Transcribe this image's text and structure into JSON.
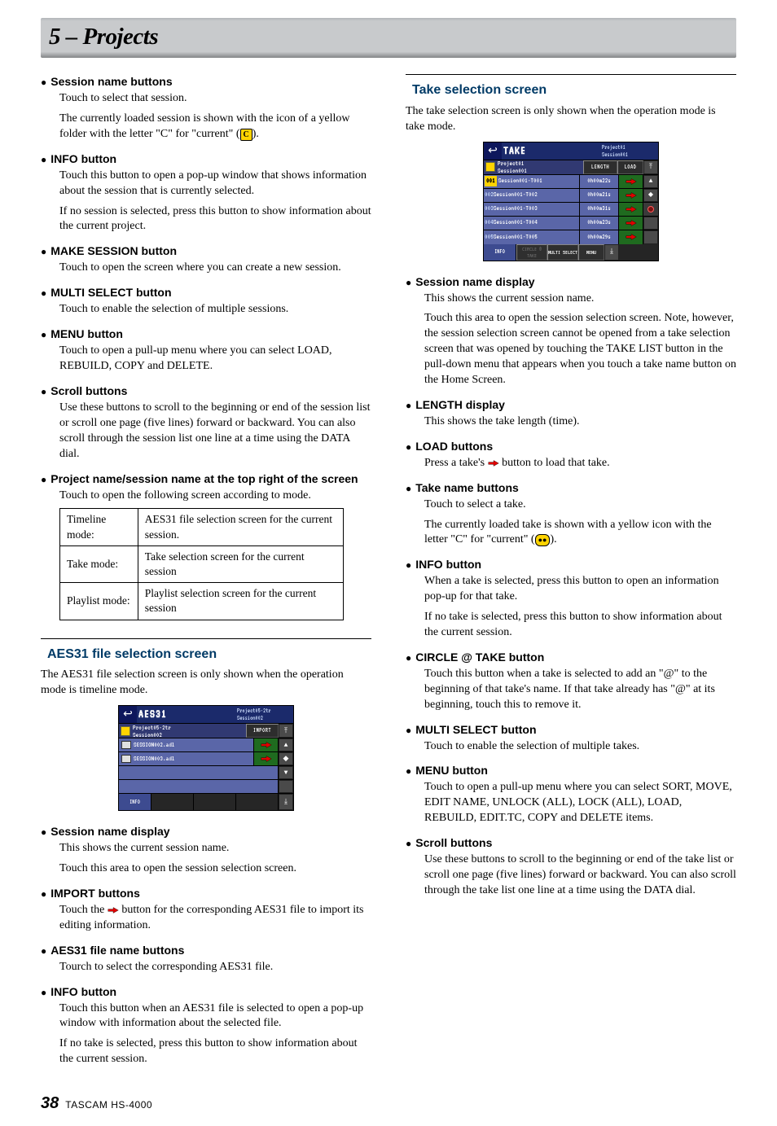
{
  "header": {
    "title": "5 – Projects"
  },
  "left": {
    "sessionNameButtons": {
      "title": "Session name buttons",
      "p1": "Touch to select that session.",
      "p2a": "The currently loaded session is shown with the icon of a yellow folder with the letter \"C\" for \"current\" (",
      "iconC": "C",
      "p2b": ")."
    },
    "infoBtn": {
      "title": "INFO button",
      "p1": "Touch this button to open a pop-up window that shows information about the session that is currently selected.",
      "p2": "If no session is selected, press this button to show information about the current project."
    },
    "makeSession": {
      "title": "MAKE SESSION button",
      "p1": "Touch to open the screen where you can create a new session."
    },
    "multiSelect": {
      "title": "MULTI SELECT button",
      "p1": "Touch to enable the selection of multiple sessions."
    },
    "menuBtn": {
      "title": "MENU button",
      "p1": "Touch to open a pull-up menu where you can select LOAD, REBUILD, COPY and DELETE."
    },
    "scrollBtn": {
      "title": "Scroll buttons",
      "p1": "Use these buttons to scroll to the beginning or end of the session list or scroll one page (five lines) forward or backward. You can also scroll through the session list one line at a time using the DATA dial."
    },
    "projSess": {
      "title": "Project name/session name at the top right of the screen",
      "p1": "Touch to open the following screen according to mode."
    },
    "table": {
      "rows": [
        [
          "Timeline mode:",
          "AES31 file selection screen for the current session."
        ],
        [
          "Take mode:",
          "Take selection screen for the current session"
        ],
        [
          "Playlist mode:",
          "Playlist selection screen for the current session"
        ]
      ]
    },
    "aes31": {
      "heading": "AES31 file selection screen",
      "lead": "The AES31 file selection screen is only shown when the operation mode is timeline mode."
    },
    "aesScreen": {
      "title": "AES31",
      "proj": "Project05-2tr\nSession002",
      "sess": "Project05-2tr\nSession002",
      "importLabel": "IMPORT",
      "items": [
        "SESSION002.adl",
        "SESSION003.adl"
      ],
      "info": "INFO"
    },
    "sessionNameDisplay": {
      "title": "Session name display",
      "p1": "This shows the current session name.",
      "p2": "Touch this area to open the session selection screen."
    },
    "importBtns": {
      "title": "IMPORT  buttons",
      "p1a": "Touch the ",
      "p1b": " button for the corresponding AES31 file to import its editing information."
    },
    "aesFileName": {
      "title": "AES31 file name buttons",
      "p1": "Tourch to select the corresponding AES31 file."
    },
    "infoBtn2": {
      "title": "INFO button",
      "p1": "Touch this button when an AES31 file is selected to open a pop-up window with information about the selected file.",
      "p2": "If no take is selected, press this button to show information about the current session."
    }
  },
  "right": {
    "takeSel": {
      "heading": "Take selection screen",
      "lead": "The take selection screen is only shown when the operation mode is take mode."
    },
    "takeScreen": {
      "title": "TAKE",
      "proj": "Project01\nSession001",
      "sess": "Project01\nSession001",
      "lengthLabel": "LENGTH",
      "loadLabel": "LOAD",
      "items": [
        {
          "n": "001",
          "name": "Session001-T001",
          "len": "0h00m22s",
          "cur": true
        },
        {
          "n": "002",
          "name": "Session001-T002",
          "len": "0h00m21s",
          "cur": false
        },
        {
          "n": "003",
          "name": "Session001-T003",
          "len": "0h00m31s",
          "cur": false
        },
        {
          "n": "004",
          "name": "Session001-T004",
          "len": "0h00m23s",
          "cur": false
        },
        {
          "n": "005",
          "name": "Session001-T005",
          "len": "0h00m29s",
          "cur": false
        }
      ],
      "info": "INFO",
      "circle": "CIRCLE @\nTAKE",
      "multi": "MULTI\nSELECT",
      "menu": "MENU"
    },
    "sessionNameDisplay": {
      "title": "Session name display",
      "p1": "This shows the current session name.",
      "p2": "Touch this area to open the session selection screen. Note, however, the session selection screen cannot be opened from a take selection screen that was opened by touching the TAKE LIST button in the pull-down menu that appears when you touch a take name button on the Home Screen."
    },
    "lengthDisplay": {
      "title": " LENGTH display",
      "p1": "This shows the take length (time)."
    },
    "loadBtns": {
      "title": " LOAD buttons",
      "p1a": "Press a take's ",
      "p1b": " button to load that take."
    },
    "takeNameBtns": {
      "title": "Take name buttons",
      "p1": "Touch to select a take.",
      "p2a": "The currently loaded take is shown with a yellow icon with the letter \"C\" for \"current\" (",
      "p2b": ")."
    },
    "infoBtn": {
      "title": "INFO button",
      "p1": "When a take is selected, press this button to open an information pop-up for that take.",
      "p2": "If no take is selected, press this button to show information about the current session."
    },
    "circleBtn": {
      "title": "CIRCLE @ TAKE button",
      "p1": "Touch this button when a take is selected to add an \"@\" to the beginning of that take's name. If that take already has \"@\" at its beginning, touch this to remove it."
    },
    "multiSelect": {
      "title": "MULTI SELECT button",
      "p1": "Touch to enable the selection of multiple takes."
    },
    "menuBtn": {
      "title": "MENU button",
      "p1": "Touch to open a pull-up menu where you can select SORT, MOVE, EDIT NAME, UNLOCK (ALL), LOCK (ALL), LOAD, REBUILD, EDIT.TC, COPY and DELETE items."
    },
    "scrollBtn": {
      "title": "Scroll buttons",
      "p1": "Use these buttons to scroll to the beginning or end of the take list or scroll one page (five lines) forward or backward. You can also scroll through the take list one line at a time using the DATA dial."
    }
  },
  "footer": {
    "page": "38",
    "model": "TASCAM  HS-4000"
  }
}
